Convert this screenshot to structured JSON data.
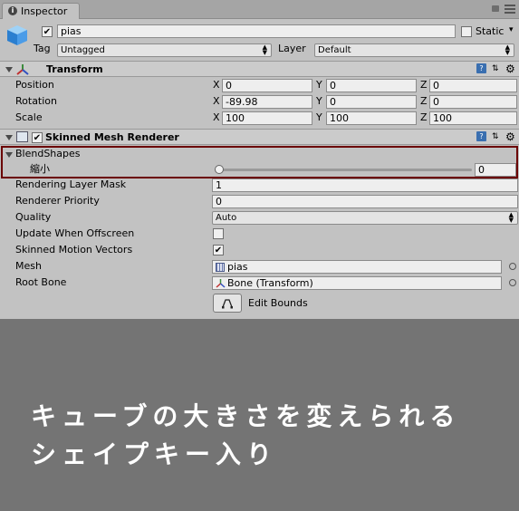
{
  "tab": {
    "label": "Inspector"
  },
  "object": {
    "name": "pias",
    "static_label": "Static",
    "tag_label": "Tag",
    "tag_value": "Untagged",
    "layer_label": "Layer",
    "layer_value": "Default"
  },
  "transform": {
    "title": "Transform",
    "rows": [
      {
        "label": "Position",
        "x": "0",
        "y": "0",
        "z": "0"
      },
      {
        "label": "Rotation",
        "x": "-89.98",
        "y": "0",
        "z": "0"
      },
      {
        "label": "Scale",
        "x": "100",
        "y": "100",
        "z": "100"
      }
    ],
    "axes": {
      "x": "X",
      "y": "Y",
      "z": "Z"
    }
  },
  "smr": {
    "title": "Skinned Mesh Renderer",
    "blendshapes_label": "BlendShapes",
    "blend_name": "縮小",
    "blend_value": "0",
    "blend_fraction": 0,
    "rows": {
      "rendering_layer_mask": {
        "label": "Rendering Layer Mask",
        "value": "1"
      },
      "renderer_priority": {
        "label": "Renderer Priority",
        "value": "0"
      },
      "quality": {
        "label": "Quality",
        "value": "Auto"
      },
      "update_offscreen": {
        "label": "Update When Offscreen"
      },
      "motion_vectors": {
        "label": "Skinned Motion Vectors"
      },
      "mesh": {
        "label": "Mesh",
        "value": "pias"
      },
      "root_bone": {
        "label": "Root Bone",
        "value": "Bone (Transform)"
      }
    },
    "edit_bounds": "Edit Bounds"
  },
  "caption": {
    "line1": "キューブの大きさを変えられる",
    "line2": "シェイプキー入り"
  },
  "colors": {
    "highlight_border": "#6b0000",
    "panel": "#c2c2c2",
    "background": "#747474"
  }
}
